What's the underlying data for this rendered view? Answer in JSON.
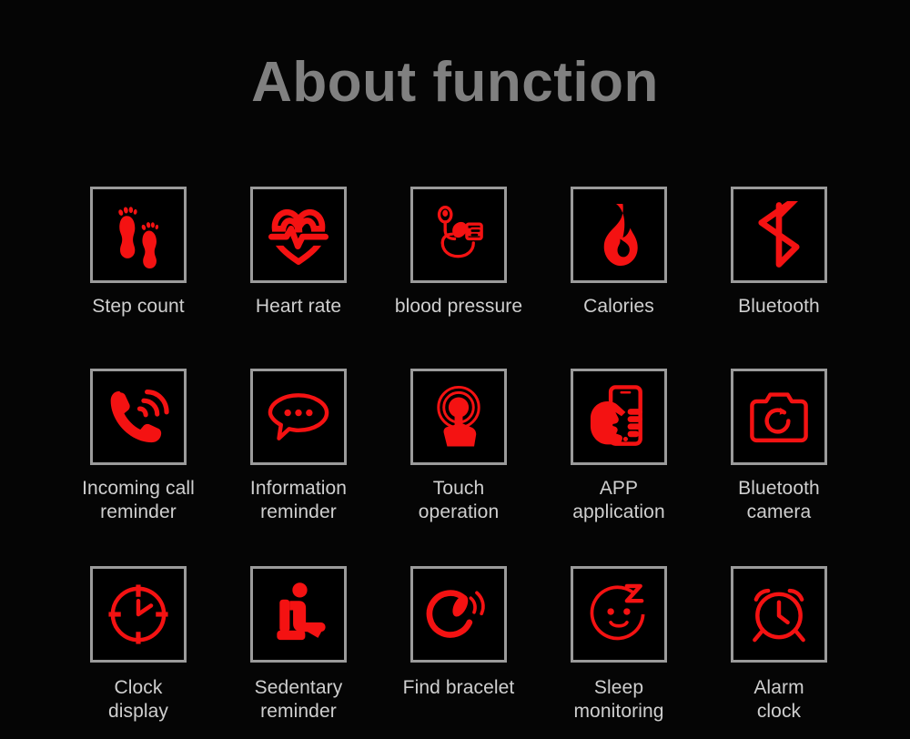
{
  "page": {
    "title": "About function",
    "background_color": "#050505",
    "title_color": "#808080",
    "accent_color": "#f41212",
    "box_border_color": "#9b9b9b",
    "label_color": "#cfcfcf"
  },
  "rows": [
    {
      "items": [
        {
          "icon": "footprints-icon",
          "label": "Step count"
        },
        {
          "icon": "heart-pulse-icon",
          "label": "Heart rate"
        },
        {
          "icon": "blood-pressure-monitor-icon",
          "label": "blood pressure"
        },
        {
          "icon": "flame-icon",
          "label": "Calories"
        },
        {
          "icon": "bluetooth-icon",
          "label": "Bluetooth"
        }
      ]
    },
    {
      "items": [
        {
          "icon": "ringing-phone-icon",
          "label": "Incoming call\nreminder"
        },
        {
          "icon": "speech-bubble-icon",
          "label": "Information\nreminder"
        },
        {
          "icon": "touch-gesture-icon",
          "label": "Touch\noperation"
        },
        {
          "icon": "hand-holding-phone-icon",
          "label": "APP\napplication"
        },
        {
          "icon": "camera-icon",
          "label": "Bluetooth\ncamera"
        }
      ]
    },
    {
      "items": [
        {
          "icon": "clock-icon",
          "label": "Clock\ndisplay"
        },
        {
          "icon": "seated-person-icon",
          "label": "Sedentary\nreminder"
        },
        {
          "icon": "bracelet-signal-icon",
          "label": "Find bracelet"
        },
        {
          "icon": "sleeping-face-icon",
          "label": "Sleep\nmonitoring"
        },
        {
          "icon": "alarm-clock-icon",
          "label": "Alarm\nclock"
        }
      ]
    }
  ]
}
